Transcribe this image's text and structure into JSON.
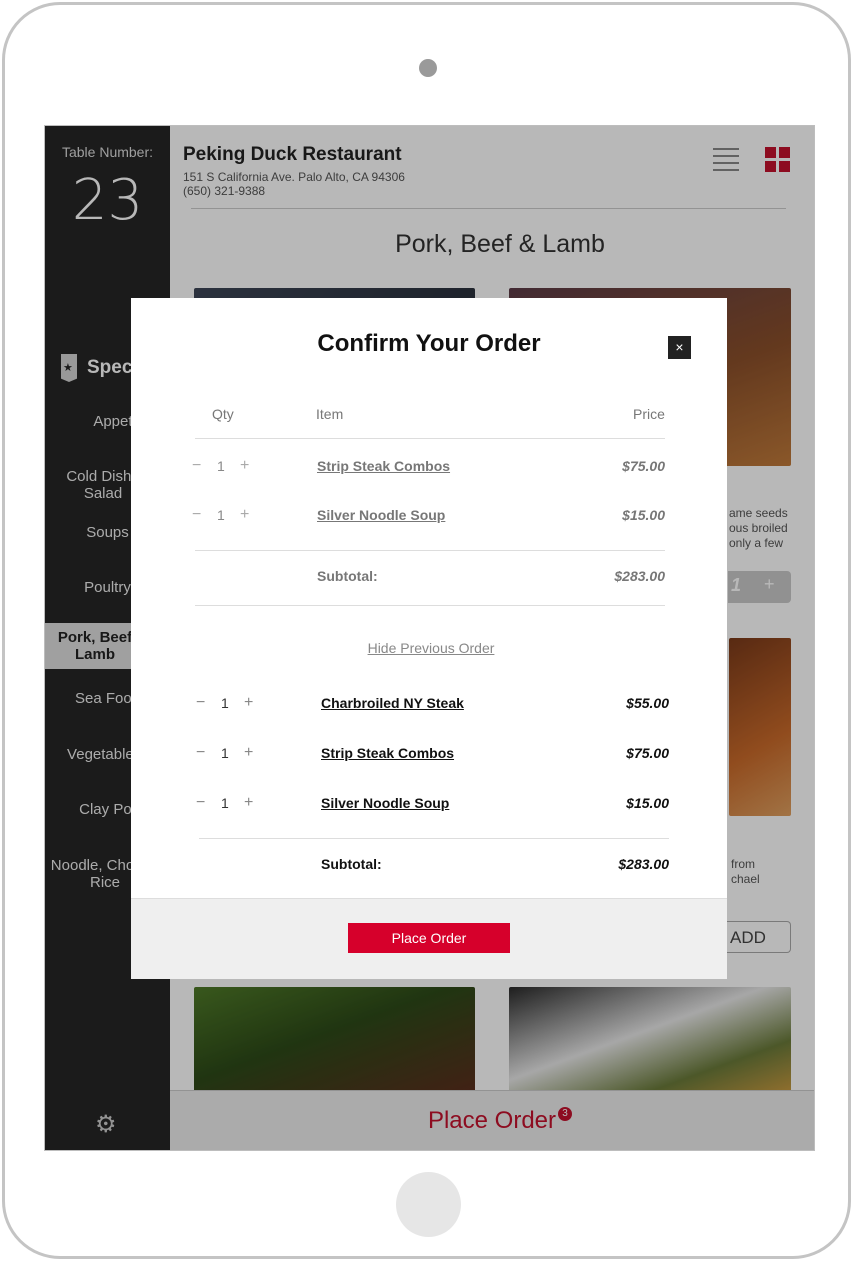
{
  "sidebar": {
    "table_label": "Table Number:",
    "table_number": "23",
    "special": "Spec",
    "items": [
      {
        "label": "Appetize"
      },
      {
        "label": "Cold Dishe Salad"
      },
      {
        "label": "Soups"
      },
      {
        "label": "Poultry"
      },
      {
        "label": "Pork, Beef Lamb"
      },
      {
        "label": "Sea Food"
      },
      {
        "label": "Vegetable &"
      },
      {
        "label": "Clay Pot"
      },
      {
        "label": "Noodle, Chow & Rice"
      }
    ]
  },
  "header": {
    "restaurant_name": "Peking Duck Restaurant",
    "address": "151 S California Ave. Palo Alto, CA 94306",
    "phone": "(650) 321-9388"
  },
  "category_title": "Pork, Beef & Lamb",
  "background_text": {
    "desc1": [
      "ame seeds",
      "ous broiled",
      "only a few"
    ],
    "stepper_qty": "1",
    "stepper_plus": "+",
    "desc2": [
      "from",
      "chael"
    ],
    "add_label": "ADD"
  },
  "bottom_bar": {
    "label": "Place Order",
    "count": "3"
  },
  "modal": {
    "title": "Confirm Your Order",
    "close": "×",
    "columns": {
      "qty": "Qty",
      "item": "Item",
      "price": "Price"
    },
    "current_items": [
      {
        "qty": "1",
        "name": "Strip Steak Combos",
        "price": "$75.00"
      },
      {
        "qty": "1",
        "name": "Silver Noodle Soup",
        "price": "$15.00"
      }
    ],
    "current_subtotal": {
      "label": "Subtotal:",
      "value": "$283.00"
    },
    "hide_previous": "Hide Previous Order",
    "previous_items": [
      {
        "qty": "1",
        "name": "Charbroiled NY Steak",
        "price": "$55.00"
      },
      {
        "qty": "1",
        "name": "Strip Steak Combos",
        "price": "$75.00"
      },
      {
        "qty": "1",
        "name": "Silver Noodle Soup",
        "price": "$15.00"
      }
    ],
    "previous_subtotal": {
      "label": "Subtotal:",
      "value": "$283.00"
    },
    "place_order": "Place Order",
    "minus": "−",
    "plus": "+"
  },
  "icons": {
    "settings": "gear-icon",
    "list_view": "list-view-icon",
    "grid_view": "grid-view-icon",
    "special": "star-badge-icon"
  },
  "colors": {
    "accent": "#d6002b",
    "sidebar": "#262626"
  }
}
